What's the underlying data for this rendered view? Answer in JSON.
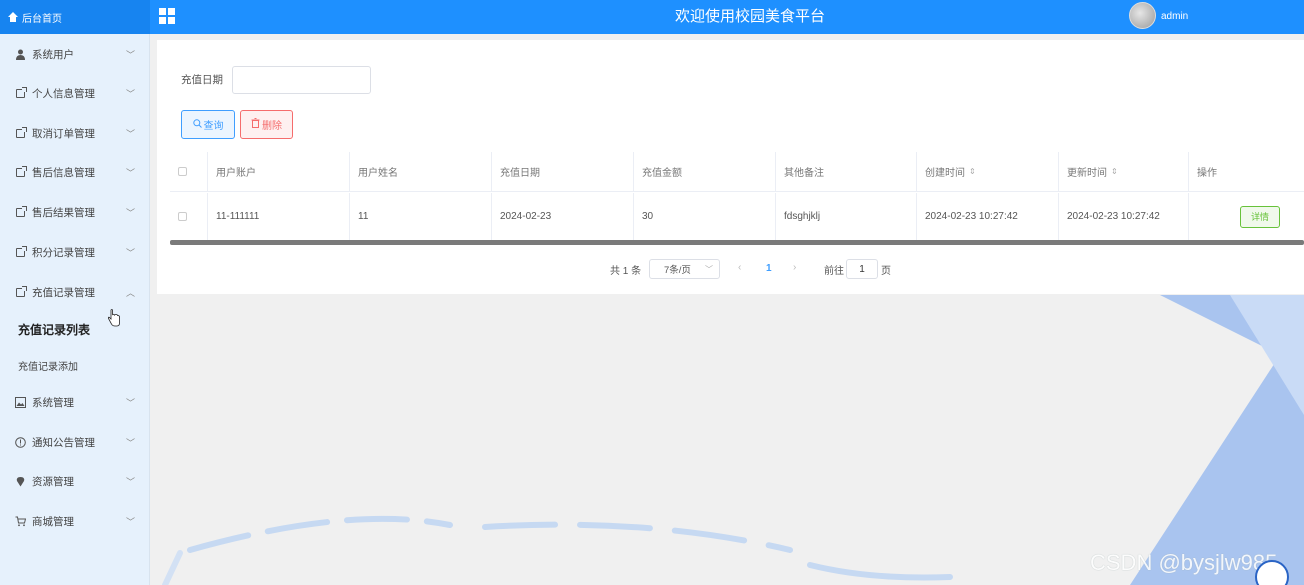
{
  "header": {
    "home_label": "后台首页",
    "title": "欢迎使用校园美食平台",
    "username": "admin",
    "accent_color": "#1e90ff"
  },
  "sidebar": {
    "items": [
      {
        "label": "系统用户",
        "icon": "user-icon",
        "expanded": false
      },
      {
        "label": "个人信息管理",
        "icon": "box-icon",
        "expanded": false
      },
      {
        "label": "取消订单管理",
        "icon": "box-icon",
        "expanded": false
      },
      {
        "label": "售后信息管理",
        "icon": "box-icon",
        "expanded": false
      },
      {
        "label": "售后结果管理",
        "icon": "box-icon",
        "expanded": false
      },
      {
        "label": "积分记录管理",
        "icon": "box-icon",
        "expanded": false
      },
      {
        "label": "充值记录管理",
        "icon": "box-icon",
        "expanded": true
      },
      {
        "label": "系统管理",
        "icon": "image-icon",
        "expanded": false
      },
      {
        "label": "通知公告管理",
        "icon": "info-icon",
        "expanded": false
      },
      {
        "label": "资源管理",
        "icon": "location-icon",
        "expanded": false
      },
      {
        "label": "商城管理",
        "icon": "cart-icon",
        "expanded": false
      }
    ],
    "sub_items": [
      {
        "label": "充值记录列表",
        "active": true
      },
      {
        "label": "充值记录添加",
        "active": false
      }
    ]
  },
  "search": {
    "date_label": "充值日期",
    "date_value": "",
    "query_label": "查询",
    "delete_label": "删除"
  },
  "table": {
    "columns": [
      "用户账户",
      "用户姓名",
      "充值日期",
      "充值金额",
      "其他备注",
      "创建时间",
      "更新时间",
      "操作"
    ],
    "rows": [
      {
        "account": "11-111111",
        "name": "11",
        "date": "2024-02-23",
        "amount": "30",
        "note": "fdsghjklj",
        "created": "2024-02-23 10:27:42",
        "updated": "2024-02-23 10:27:42",
        "action": "详情"
      }
    ]
  },
  "pagination": {
    "total_text": "共 1 条",
    "page_size": "7条/页",
    "current_page": "1",
    "goto_label": "前往",
    "goto_value": "1",
    "page_suffix": "页"
  },
  "watermark": "CSDN @bysjlw985"
}
